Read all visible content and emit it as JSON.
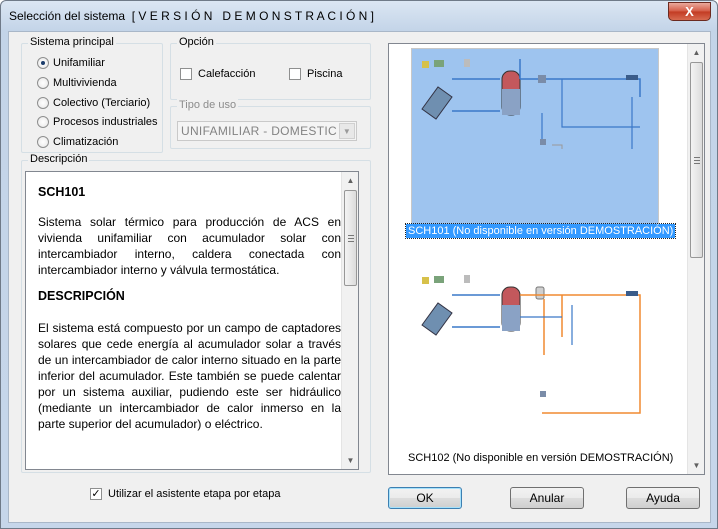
{
  "window": {
    "title": "Selección del sistema  [ V E R S I Ó N   D E M O N S T R A C I Ó N ]",
    "close_label": "X"
  },
  "sistema": {
    "legend": "Sistema principal",
    "options": [
      {
        "label": "Unifamiliar",
        "selected": true
      },
      {
        "label": "Multivivienda",
        "selected": false
      },
      {
        "label": "Colectivo (Terciario)",
        "selected": false
      },
      {
        "label": "Procesos industriales",
        "selected": false
      },
      {
        "label": "Climatización",
        "selected": false
      }
    ]
  },
  "opcion": {
    "legend": "Opción",
    "calefaccion": {
      "label": "Calefacción",
      "checked": false
    },
    "piscina": {
      "label": "Piscina",
      "checked": false
    }
  },
  "tipo_uso": {
    "legend": "Tipo de uso",
    "value": "UNIFAMILIAR - DOMESTIC",
    "arrow": "▼"
  },
  "descripcion": {
    "legend": "Descripción",
    "code": "SCH101",
    "summary": "Sistema solar térmico para producción de ACS en vivienda unifamiliar con acumulador solar con intercambiador interno, caldera conectada con intercambiador interno y válvula termostática.",
    "heading": "DESCRIPCIÓN",
    "body": "El sistema está compuesto por un campo de captadores solares que cede energía al acumulador solar a través de un intercambiador de calor interno situado en la parte inferior del acumulador. Este también se puede calentar por un sistema auxiliar, pudiendo este ser hidráulico (mediante un intercambiador de calor inmerso en la parte superior del acumulador) o eléctrico."
  },
  "schemes": [
    {
      "caption": "SCH101 (No disponible en versión DEMOSTRACIÓN)",
      "selected": true
    },
    {
      "caption": "SCH102 (No disponible en versión DEMOSTRACIÓN)",
      "selected": false
    }
  ],
  "wizard": {
    "label": "Utilizar el asistente etapa por etapa",
    "checked": true,
    "mark": "✓"
  },
  "buttons": {
    "ok": "OK",
    "cancel": "Anular",
    "help": "Ayuda"
  },
  "scroll_arrows": {
    "up": "▲",
    "down": "▼"
  },
  "colors": {
    "selection": "#3399ff",
    "thumb_selected_bg": "#9ec4ef",
    "pipe_orange": "#f08a30",
    "pipe_blue": "#3a78c8"
  }
}
